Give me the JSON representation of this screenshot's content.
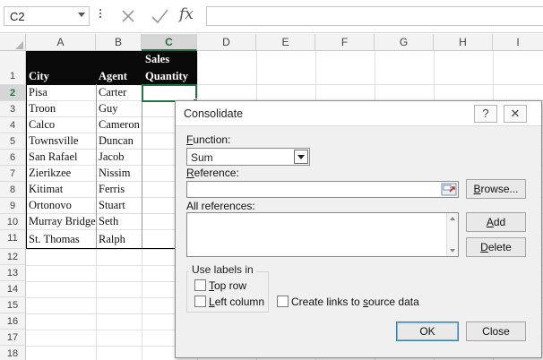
{
  "formula_bar": {
    "name_box": "C2",
    "fx_label": "fx",
    "formula_value": ""
  },
  "grid": {
    "columns": [
      "A",
      "B",
      "C",
      "D",
      "E",
      "F",
      "G",
      "H",
      "I"
    ],
    "rows": [
      "1",
      "2",
      "3",
      "4",
      "5",
      "6",
      "7",
      "8",
      "9",
      "10",
      "11",
      "12",
      "13",
      "14",
      "15",
      "16",
      "17",
      "18"
    ],
    "headers": {
      "city": "City",
      "agent": "Agent",
      "sales_line1": "Sales",
      "sales_line2": "Quantity"
    },
    "records": [
      {
        "city": "Pisa",
        "agent": "Carter"
      },
      {
        "city": "Troon",
        "agent": "Guy"
      },
      {
        "city": "Calco",
        "agent": "Cameron"
      },
      {
        "city": "Townsville",
        "agent": "Duncan"
      },
      {
        "city": "San Rafael",
        "agent": "Jacob"
      },
      {
        "city": "Zierikzee",
        "agent": "Nissim"
      },
      {
        "city": "Kitimat",
        "agent": "Ferris"
      },
      {
        "city": "Ortonovo",
        "agent": "Stuart"
      },
      {
        "city": "Murray Bridge",
        "agent": "Seth"
      },
      {
        "city": "St. Thomas",
        "agent": "Ralph"
      }
    ],
    "active_cell": "C2"
  },
  "dialog": {
    "title": "Consolidate",
    "help_glyph": "?",
    "close_glyph": "✕",
    "function": {
      "label_pre": "",
      "label_key": "F",
      "label_post": "unction:",
      "value": "Sum"
    },
    "reference": {
      "label_pre": "",
      "label_key": "R",
      "label_post": "eference:",
      "value": ""
    },
    "all_references_label": "All references:",
    "buttons": {
      "browse_key": "B",
      "browse_post": "rowse...",
      "add_key": "A",
      "add_post": "dd",
      "delete_key": "D",
      "delete_post": "elete",
      "ok": "OK",
      "close": "Close"
    },
    "use_labels": {
      "legend": "Use labels in",
      "top_row_key": "T",
      "top_row_post": "op row",
      "left_column_key": "L",
      "left_column_post": "eft column"
    },
    "links": {
      "pre": "Create links to ",
      "key": "s",
      "post": "ource data"
    }
  },
  "colors": {
    "excel_green": "#217346",
    "header_black": "#0a0a0a",
    "dialog_bg": "#f0f0f0"
  }
}
